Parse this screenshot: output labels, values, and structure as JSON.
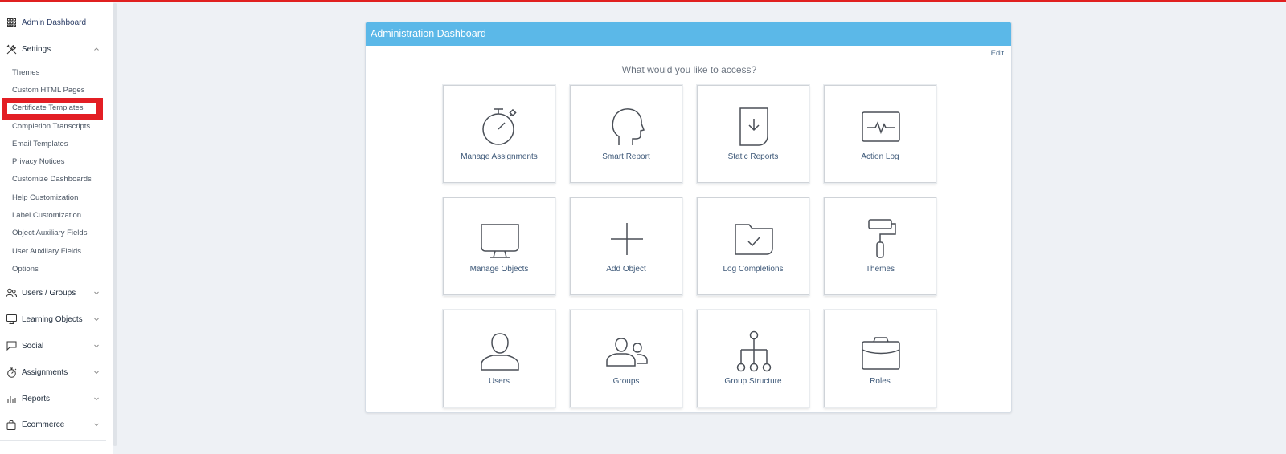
{
  "sidebar": {
    "admin_dashboard": "Admin Dashboard",
    "settings": {
      "label": "Settings",
      "items": [
        "Themes",
        "Custom HTML Pages",
        "Certificate Templates",
        "Completion Transcripts",
        "Email Templates",
        "Privacy Notices",
        "Customize Dashboards",
        "Help Customization",
        "Label Customization",
        "Object Auxiliary Fields",
        "User Auxiliary Fields",
        "Options"
      ]
    },
    "sections": [
      {
        "label": "Users / Groups",
        "icon": "users-icon"
      },
      {
        "label": "Learning Objects",
        "icon": "monitor-icon"
      },
      {
        "label": "Social",
        "icon": "chat-bubble-icon"
      },
      {
        "label": "Assignments",
        "icon": "stopwatch-icon"
      },
      {
        "label": "Reports",
        "icon": "bar-chart-icon"
      },
      {
        "label": "Ecommerce",
        "icon": "shopping-bag-icon"
      }
    ]
  },
  "panel": {
    "title": "Administration Dashboard",
    "edit_label": "Edit",
    "prompt": "What would you like to access?",
    "tiles": [
      {
        "label": "Manage Assignments",
        "icon": "stopwatch-icon"
      },
      {
        "label": "Smart Report",
        "icon": "head-profile-icon"
      },
      {
        "label": "Static Reports",
        "icon": "document-download-icon"
      },
      {
        "label": "Action Log",
        "icon": "activity-monitor-icon"
      },
      {
        "label": "Manage Objects",
        "icon": "monitor-icon"
      },
      {
        "label": "Add Object",
        "icon": "plus-icon"
      },
      {
        "label": "Log Completions",
        "icon": "folder-check-icon"
      },
      {
        "label": "Themes",
        "icon": "paint-roller-icon"
      },
      {
        "label": "Users",
        "icon": "user-icon"
      },
      {
        "label": "Groups",
        "icon": "group-icon"
      },
      {
        "label": "Group Structure",
        "icon": "hierarchy-icon"
      },
      {
        "label": "Roles",
        "icon": "briefcase-icon"
      }
    ]
  },
  "colors": {
    "header": "#5bb8e8",
    "highlight": "#e31e24",
    "topline": "#e02020"
  }
}
